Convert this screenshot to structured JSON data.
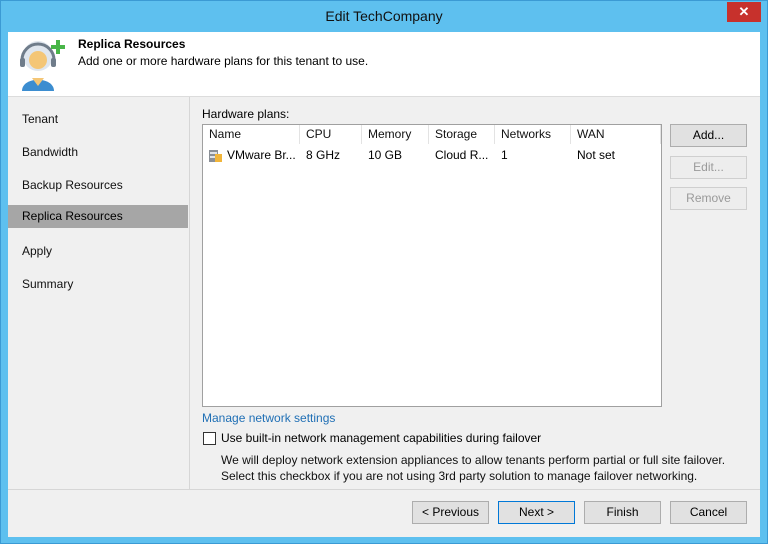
{
  "window": {
    "title": "Edit TechCompany",
    "close_label": "✕"
  },
  "header": {
    "title": "Replica Resources",
    "subtitle": "Add one or more hardware plans for this tenant to use.",
    "icon": "tenant-add-icon"
  },
  "nav": {
    "items": [
      {
        "label": "Tenant",
        "active": false
      },
      {
        "label": "Bandwidth",
        "active": false
      },
      {
        "label": "Backup Resources",
        "active": false
      },
      {
        "label": "Replica Resources",
        "active": true
      },
      {
        "label": "Apply",
        "active": false
      },
      {
        "label": "Summary",
        "active": false
      }
    ]
  },
  "hardware_plans": {
    "label": "Hardware plans:",
    "columns": [
      "Name",
      "CPU",
      "Memory",
      "Storage",
      "Networks",
      "WAN"
    ],
    "rows": [
      {
        "name": "VMware Br...",
        "cpu": "8 GHz",
        "memory": "10 GB",
        "storage": "Cloud R...",
        "networks": "1",
        "wan": "Not set",
        "icon": "hardware-plan-icon"
      }
    ]
  },
  "side_buttons": {
    "add": "Add...",
    "edit": "Edit...",
    "remove": "Remove"
  },
  "network": {
    "link": "Manage network settings",
    "checkbox_label": "Use built-in network management capabilities during failover",
    "checked": false,
    "description_line1": "We will deploy network extension appliances to allow tenants perform partial or full site failover.",
    "description_line2": "Select this checkbox if you are not using 3rd party solution to manage failover networking."
  },
  "footer": {
    "previous": "< Previous",
    "next": "Next >",
    "finish": "Finish",
    "cancel": "Cancel"
  },
  "colors": {
    "titlebar": "#5ec0ef",
    "close": "#c7312c",
    "nav_active": "#a6a6a6",
    "link": "#1f6fb5"
  }
}
